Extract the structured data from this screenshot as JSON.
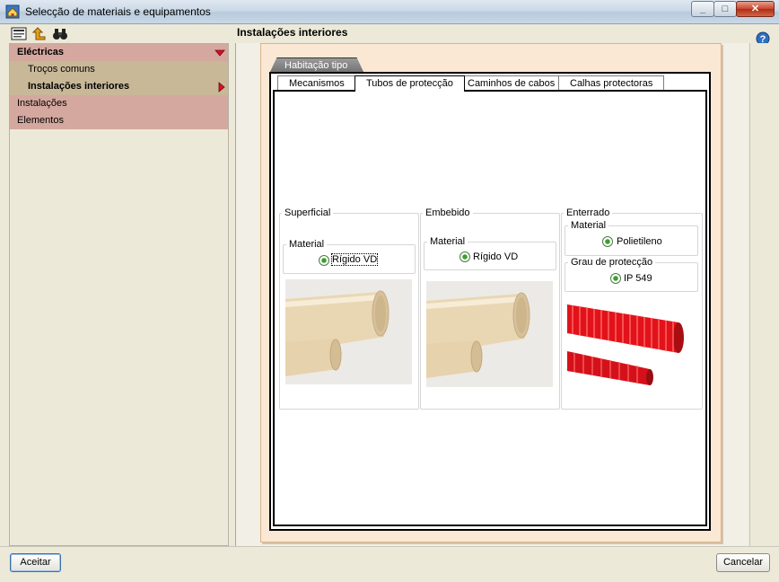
{
  "window": {
    "title": "Selecção de materiais e equipamentos",
    "min": "_",
    "max": "□",
    "close": "✕"
  },
  "tree": {
    "items": [
      {
        "label": "Eléctricas",
        "level": 1,
        "bold": true,
        "expanded": true
      },
      {
        "label": "Troços comuns",
        "level": 2
      },
      {
        "label": "Instalações interiores",
        "level": 2,
        "bold": true,
        "selected": true
      },
      {
        "label": "Instalações",
        "level": 1
      },
      {
        "label": "Elementos",
        "level": 1
      }
    ]
  },
  "section_title": "Instalações interiores",
  "outer_tab": "Habitação tipo",
  "inner_tabs": [
    "Mecanismos",
    "Tubos de protecção",
    "Caminhos de cabos",
    "Calhas protectoras"
  ],
  "active_inner_tab": "Tubos de protecção",
  "groups": {
    "superficial": {
      "title": "Superficial",
      "material_label": "Material",
      "material_value": "Rígido VD"
    },
    "embebido": {
      "title": "Embebido",
      "material_label": "Material",
      "material_value": "Rígido VD"
    },
    "enterrado": {
      "title": "Enterrado",
      "material_label": "Material",
      "material_value": "Polietileno",
      "grau_label": "Grau de protecção",
      "grau_value": "IP 549"
    }
  },
  "buttons": {
    "accept": "Aceitar",
    "cancel": "Cancelar"
  },
  "colors": {
    "tree_l1": "#d4a89e",
    "tree_l2": "#c8b898",
    "radio_dot": "#3c9e2f",
    "red_arrow": "#cc0000",
    "frame_bg": "#fbe8d4"
  }
}
